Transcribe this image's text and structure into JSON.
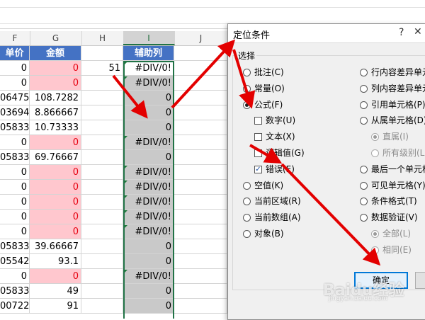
{
  "sheet": {
    "columns": [
      "F",
      "G",
      "H",
      "I",
      "J"
    ],
    "headers": {
      "price": "单价",
      "amount": "金额",
      "helper": "辅助列"
    },
    "h_value": "51",
    "rows": [
      {
        "f": "0",
        "g": "0",
        "g_pink": true,
        "i": "#DIV/0!",
        "i_err": true
      },
      {
        "f": "0",
        "g": "0",
        "g_pink": true,
        "i": "#DIV/0!",
        "i_err": true
      },
      {
        "f": "06475",
        "g": "108.7282",
        "g_pink": false,
        "i": "0",
        "i_err": false
      },
      {
        "f": "03694",
        "g": "8.866667",
        "g_pink": false,
        "i": "0",
        "i_err": false
      },
      {
        "f": "05833",
        "g": "10.73333",
        "g_pink": false,
        "i": "0",
        "i_err": false
      },
      {
        "f": "0",
        "g": "0",
        "g_pink": true,
        "i": "#DIV/0!",
        "i_err": true
      },
      {
        "f": "05833",
        "g": "69.76667",
        "g_pink": false,
        "i": "0",
        "i_err": false
      },
      {
        "f": "0",
        "g": "0",
        "g_pink": true,
        "i": "#DIV/0!",
        "i_err": true
      },
      {
        "f": "0",
        "g": "0",
        "g_pink": true,
        "i": "#DIV/0!",
        "i_err": true
      },
      {
        "f": "0",
        "g": "0",
        "g_pink": true,
        "i": "#DIV/0!",
        "i_err": true
      },
      {
        "f": "0",
        "g": "0",
        "g_pink": true,
        "i": "#DIV/0!",
        "i_err": true
      },
      {
        "f": "0",
        "g": "0",
        "g_pink": true,
        "i": "#DIV/0!",
        "i_err": true
      },
      {
        "f": "05833",
        "g": "39.66667",
        "g_pink": false,
        "i": "0",
        "i_err": false
      },
      {
        "f": "05542",
        "g": "93.1",
        "g_pink": false,
        "i": "0",
        "i_err": false
      },
      {
        "f": "0",
        "g": "0",
        "g_pink": true,
        "i": "#DIV/0!",
        "i_err": true
      },
      {
        "f": "05833",
        "g": "49",
        "g_pink": false,
        "i": "0",
        "i_err": false
      },
      {
        "f": "00722",
        "g": "91",
        "g_pink": false,
        "i": "0",
        "i_err": false
      }
    ]
  },
  "dialog": {
    "title": "定位条件",
    "help_glyph": "?",
    "close_glyph": "✕",
    "group_label": "选择",
    "left_options": [
      {
        "label": "批注(C)",
        "type": "radio",
        "checked": false,
        "disabled": false
      },
      {
        "label": "常量(O)",
        "type": "radio",
        "checked": false,
        "disabled": false
      },
      {
        "label": "公式(F)",
        "type": "radio",
        "checked": true,
        "disabled": false
      },
      {
        "label": "数字(U)",
        "type": "check",
        "checked": false,
        "disabled": false
      },
      {
        "label": "文本(X)",
        "type": "check",
        "checked": false,
        "disabled": false
      },
      {
        "label": "逻辑值(G)",
        "type": "check",
        "checked": false,
        "disabled": false
      },
      {
        "label": "错误(E)",
        "type": "check",
        "checked": true,
        "disabled": false
      },
      {
        "label": "空值(K)",
        "type": "radio",
        "checked": false,
        "disabled": false
      },
      {
        "label": "当前区域(R)",
        "type": "radio",
        "checked": false,
        "disabled": false
      },
      {
        "label": "当前数组(A)",
        "type": "radio",
        "checked": false,
        "disabled": false
      },
      {
        "label": "对象(B)",
        "type": "radio",
        "checked": false,
        "disabled": false
      }
    ],
    "right_options": [
      {
        "label": "行内容差异单元",
        "type": "radio",
        "checked": false,
        "disabled": false
      },
      {
        "label": "列内容差异单元",
        "type": "radio",
        "checked": false,
        "disabled": false
      },
      {
        "label": "引用单元格(P)",
        "type": "radio",
        "checked": false,
        "disabled": false
      },
      {
        "label": "从属单元格(D)",
        "type": "radio",
        "checked": false,
        "disabled": false
      },
      {
        "label": "直属(I)",
        "type": "radio",
        "checked": true,
        "disabled": true
      },
      {
        "label": "所有级别(L)",
        "type": "radio",
        "checked": false,
        "disabled": true
      },
      {
        "label": "最后一个单元格",
        "type": "radio",
        "checked": false,
        "disabled": false
      },
      {
        "label": "可见单元格(Y)",
        "type": "radio",
        "checked": false,
        "disabled": false
      },
      {
        "label": "条件格式(T)",
        "type": "radio",
        "checked": false,
        "disabled": false
      },
      {
        "label": "数据验证(V)",
        "type": "radio",
        "checked": false,
        "disabled": false
      },
      {
        "label": "全部(L)",
        "type": "radio",
        "checked": true,
        "disabled": true
      },
      {
        "label": "相同(E)",
        "type": "radio",
        "checked": false,
        "disabled": true
      }
    ],
    "ok_label": "确定"
  },
  "watermark": {
    "text": "Baidu经验",
    "url": "jingyan.baidu.com"
  },
  "colors": {
    "header_blue": "#4472c4",
    "error_pink": "#ffc7ce",
    "error_red": "#e6000f",
    "arrow_red": "#e30000",
    "selection_green": "#217346"
  }
}
